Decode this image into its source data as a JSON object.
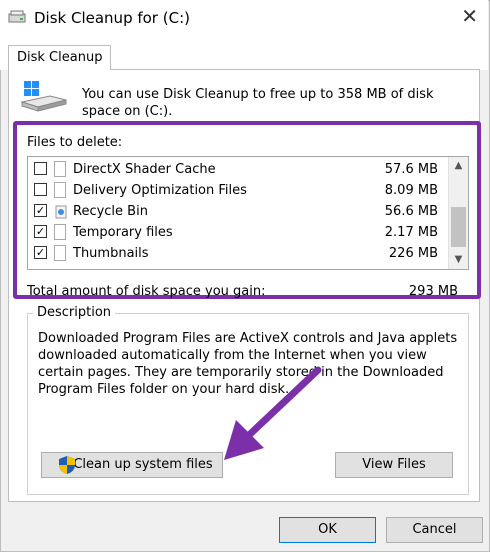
{
  "window": {
    "title": "Disk Cleanup for  (C:)",
    "tab_label": "Disk Cleanup"
  },
  "intro_text": "You can use Disk Cleanup to free up to 358 MB of disk space on (C:).",
  "files": {
    "label": "Files to delete:",
    "items": [
      {
        "name": "DirectX Shader Cache",
        "size": "57.6 MB",
        "checked": false,
        "icon": "document-icon"
      },
      {
        "name": "Delivery Optimization Files",
        "size": "8.09 MB",
        "checked": false,
        "icon": "document-icon"
      },
      {
        "name": "Recycle Bin",
        "size": "56.6 MB",
        "checked": true,
        "icon": "recycle-bin-icon"
      },
      {
        "name": "Temporary files",
        "size": "2.17 MB",
        "checked": true,
        "icon": "document-icon"
      },
      {
        "name": "Thumbnails",
        "size": "226 MB",
        "checked": true,
        "icon": "document-icon"
      }
    ]
  },
  "total": {
    "label": "Total amount of disk space you gain:",
    "value": "293 MB"
  },
  "description": {
    "legend": "Description",
    "text": "Downloaded Program Files are ActiveX controls and Java applets downloaded automatically from the Internet when you view certain pages. They are temporarily stored in the Downloaded Program Files folder on your hard disk."
  },
  "buttons": {
    "cleanup_system": "Clean up system files",
    "view_files": "View Files",
    "ok": "OK",
    "cancel": "Cancel"
  },
  "colors": {
    "highlight": "#7b2fa8",
    "accent": "#0078d7"
  }
}
